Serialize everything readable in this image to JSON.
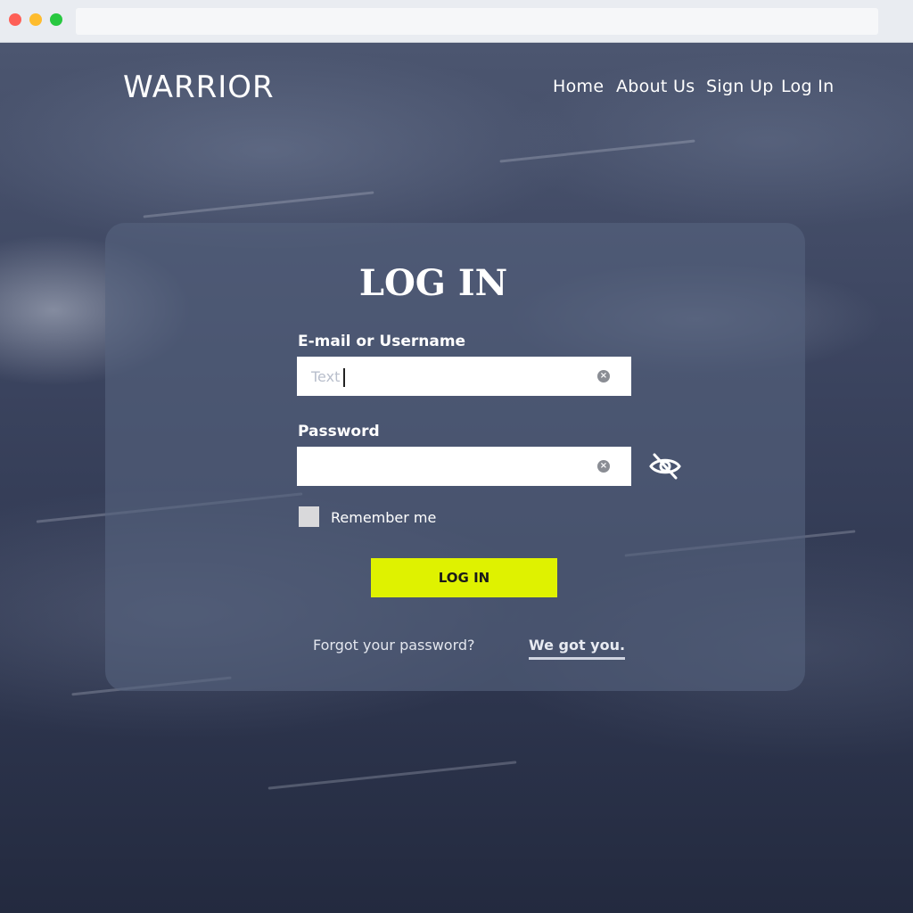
{
  "brand": {
    "logo_text": "WARRIOR"
  },
  "nav": {
    "home": "Home",
    "about": "About Us",
    "signup": "Sign Up",
    "login": "Log In"
  },
  "form": {
    "title": "LOG IN",
    "email_label": "E-mail or Username",
    "email_placeholder": "Text",
    "password_label": "Password",
    "remember_label": "Remember me",
    "submit_label": "LOG IN",
    "forgot_text": "Forgot your password?",
    "forgot_link": "We got you."
  },
  "colors": {
    "accent": "#dff200",
    "card": "#56627e"
  },
  "icons": {
    "clear": "clear-icon",
    "visibility": "eye-off-icon"
  }
}
